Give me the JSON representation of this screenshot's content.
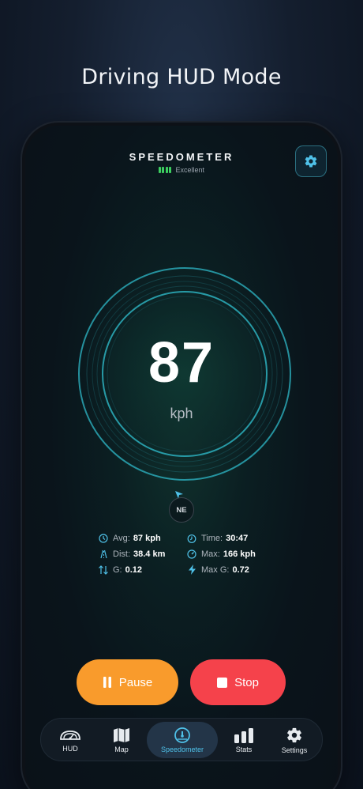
{
  "headline": "Driving HUD Mode",
  "app": {
    "title": "SPEEDOMETER",
    "signal_label": "Excellent",
    "settings_icon": "gear-icon"
  },
  "speed": {
    "value": "87",
    "unit": "kph"
  },
  "compass": {
    "heading": "NE"
  },
  "stats": [
    {
      "icon": "clock-icon",
      "label": "Avg:",
      "value": "87 kph"
    },
    {
      "icon": "timer-icon",
      "label": "Time:",
      "value": "30:47"
    },
    {
      "icon": "road-icon",
      "label": "Dist:",
      "value": "38.4 km"
    },
    {
      "icon": "gauge-icon",
      "label": "Max:",
      "value": "166 kph"
    },
    {
      "icon": "arrows-updown-icon",
      "label": "G:",
      "value": "0.12"
    },
    {
      "icon": "bolt-icon",
      "label": "Max G:",
      "value": "0.72"
    }
  ],
  "controls": {
    "pause_label": "Pause",
    "stop_label": "Stop"
  },
  "tabs": [
    {
      "label": "HUD",
      "icon": "hud-icon",
      "active": false
    },
    {
      "label": "Map",
      "icon": "map-icon",
      "active": false
    },
    {
      "label": "Speedometer",
      "icon": "speedometer-icon",
      "active": true
    },
    {
      "label": "Stats",
      "icon": "bar-chart-icon",
      "active": false
    },
    {
      "label": "Settings",
      "icon": "gear-icon",
      "active": false
    }
  ],
  "colors": {
    "accent": "#4fc1e8",
    "pause": "#f99b2c",
    "stop": "#f5424b",
    "signal": "#3ccf60",
    "ring": "#2aa7b5"
  }
}
